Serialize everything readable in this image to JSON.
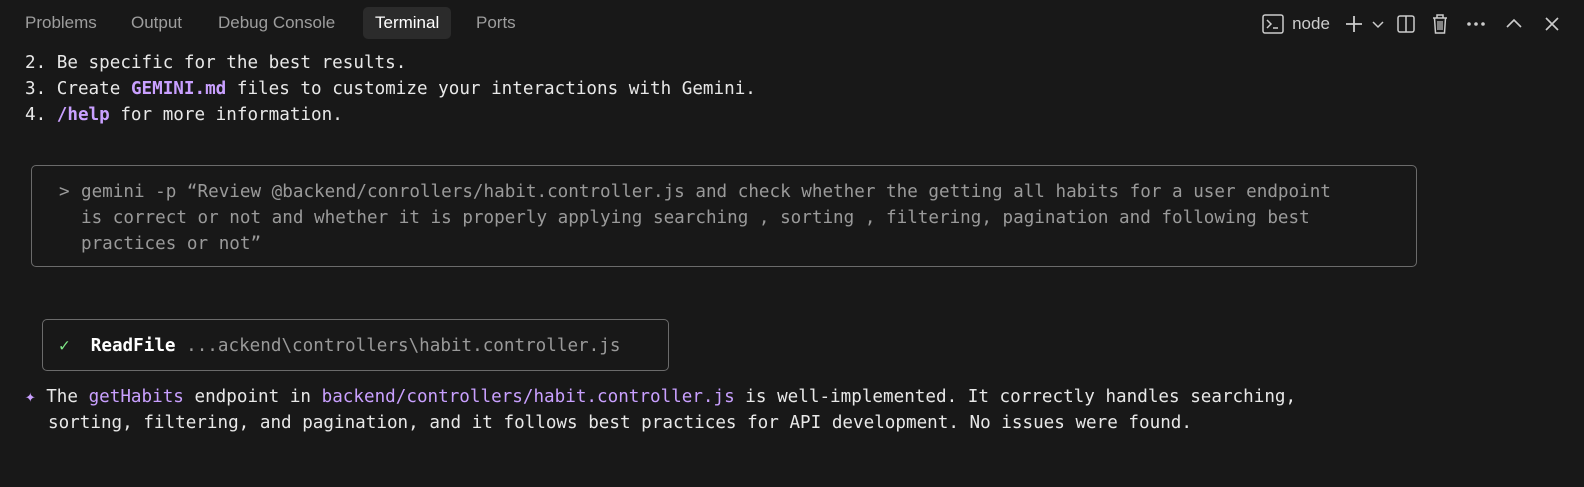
{
  "tabs": [
    {
      "label": "Problems"
    },
    {
      "label": "Output"
    },
    {
      "label": "Debug Console"
    },
    {
      "label": "Terminal"
    },
    {
      "label": "Ports"
    }
  ],
  "active_tab": "Terminal",
  "terminal_actions": {
    "profile_label": "node",
    "icons": [
      "terminal-icon",
      "plus-icon",
      "chevron-down-icon",
      "split-icon",
      "trash-icon",
      "more-icon",
      "chevron-up-icon",
      "close-icon"
    ]
  },
  "tips": {
    "tip2": "2. Be specific for the best results.",
    "tip3_prefix": "3. Create ",
    "tip3_highlight": "GEMINI.md",
    "tip3_suffix": " files to customize your interactions with Gemini.",
    "tip4_prefix": "4. ",
    "tip4_highlight": "/help",
    "tip4_suffix": " for more information."
  },
  "prompt": {
    "symbol": ">",
    "lines": [
      "gemini -p “Review @backend/conrollers/habit.controller.js and check whether the getting all habits for a user endpoint",
      "is correct or not and whether it is properly applying searching , sorting , filtering, pagination and following best",
      "practices or not”"
    ]
  },
  "tool_call": {
    "status_icon": "✓",
    "name": "ReadFile",
    "path": "...ackend\\controllers\\habit.controller.js"
  },
  "response": {
    "marker": "✦",
    "line1_a": "The ",
    "line1_b": "getHabits",
    "line1_c": " endpoint in ",
    "line1_d": "backend/controllers/habit.controller.js",
    "line1_e": " is well-implemented. It correctly handles searching,",
    "line2": "sorting, filtering, and pagination, and it follows best practices for API development. No issues were found."
  },
  "colors": {
    "background": "#181818",
    "accent_purple": "#c9a0ff",
    "check_green": "#7ee787",
    "border": "#6b6b6b"
  }
}
